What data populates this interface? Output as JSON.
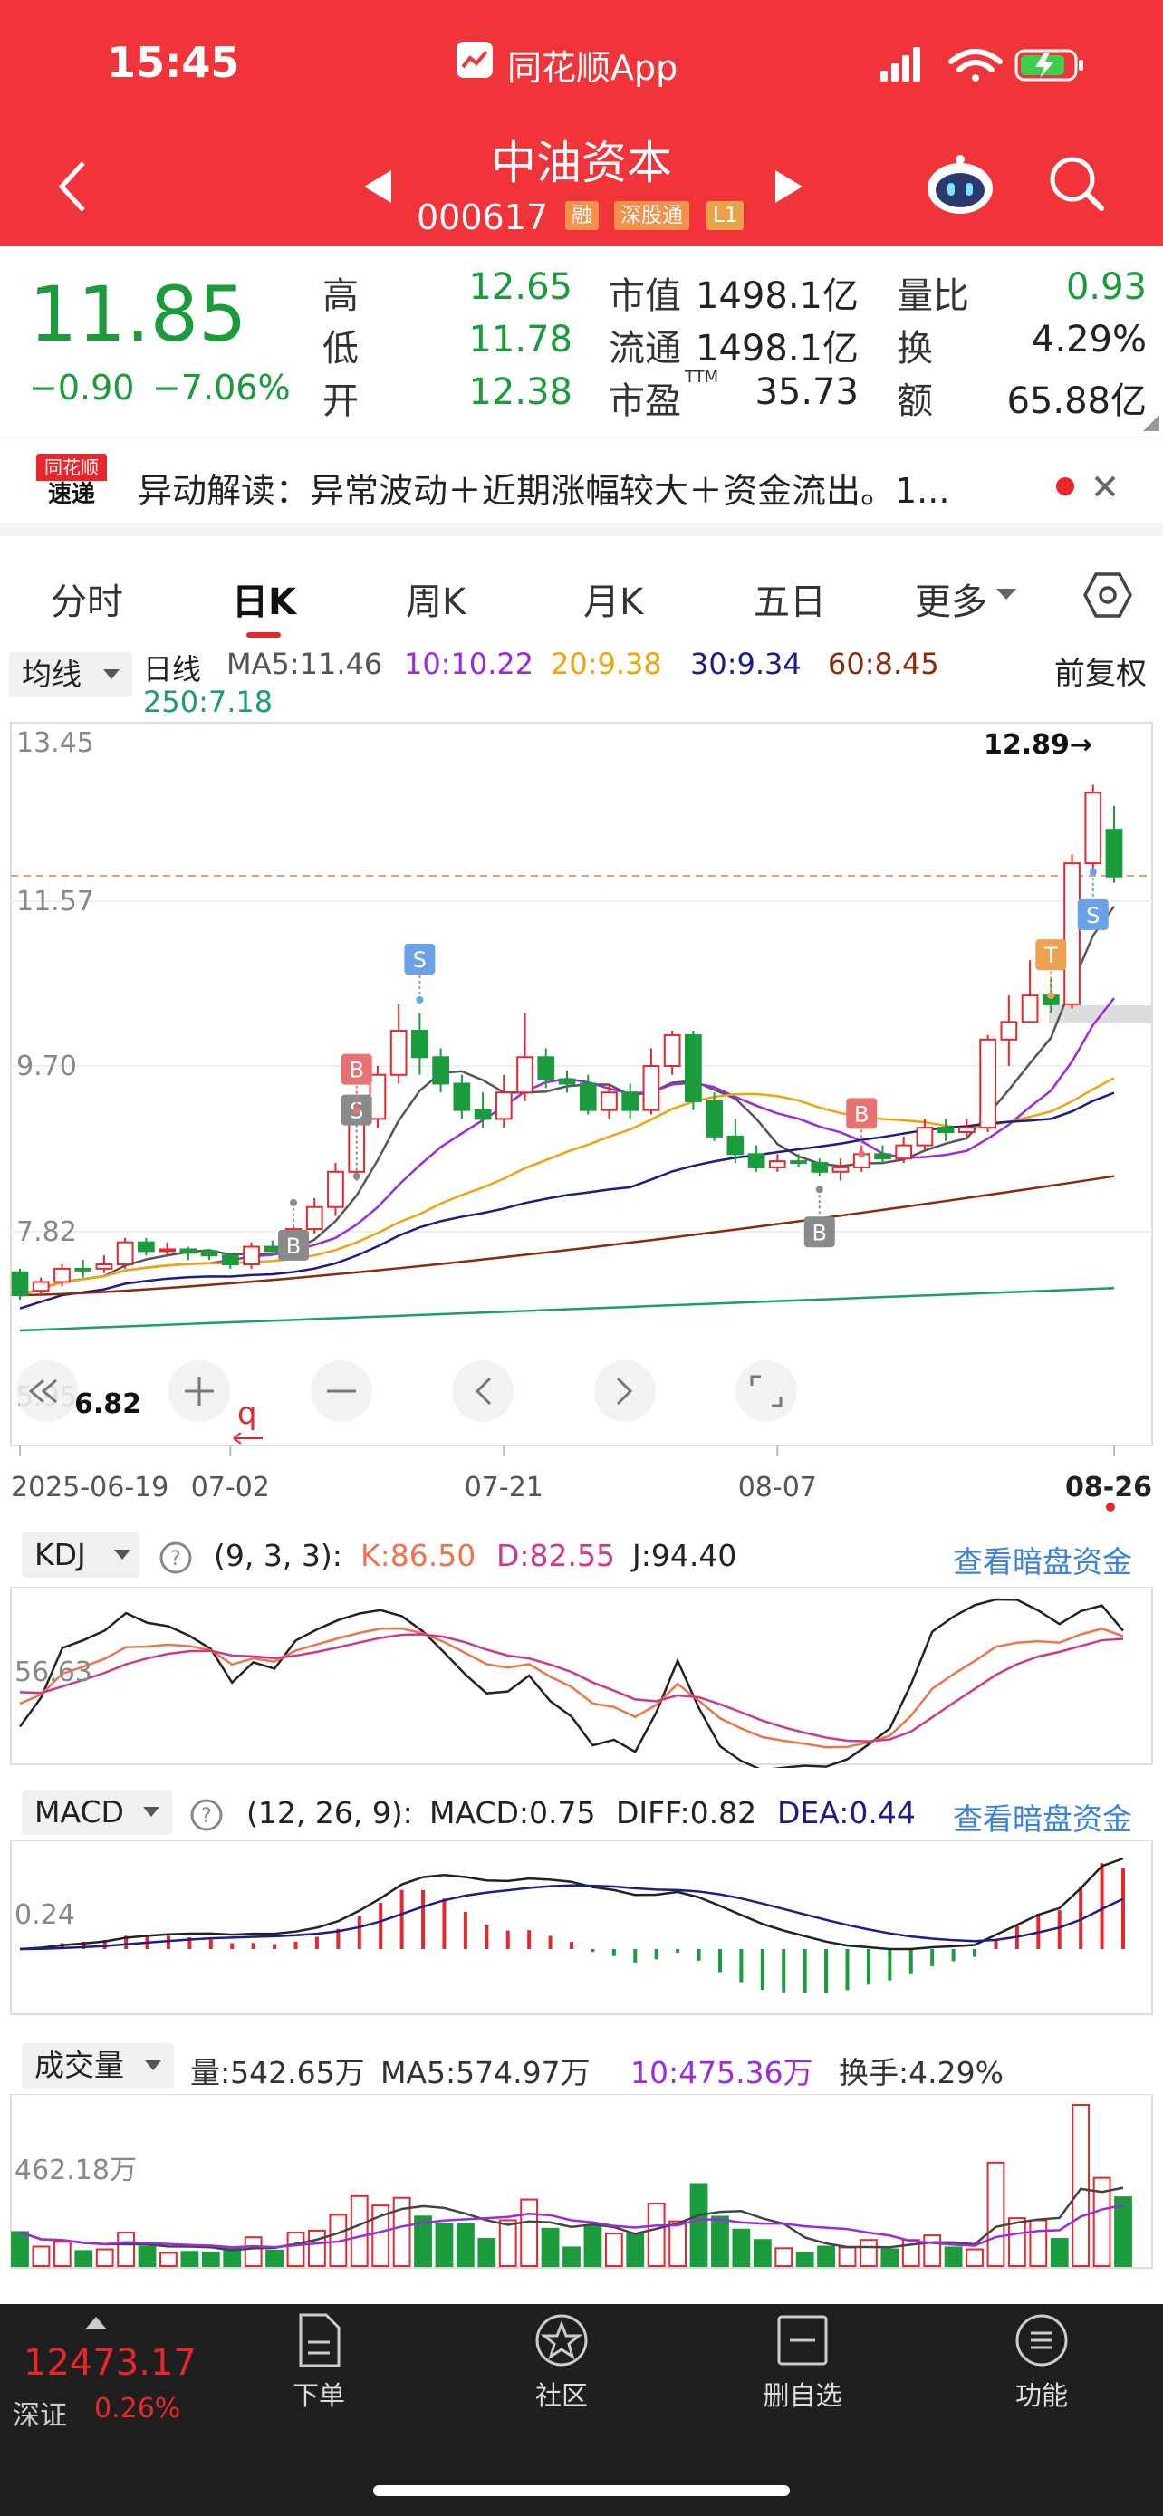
{
  "status_bar": {
    "time": "15:45",
    "app_name": "同花顺App"
  },
  "header": {
    "stock_name": "中油资本",
    "stock_code": "000617",
    "tags": [
      "融",
      "深股通",
      "L1"
    ]
  },
  "colors": {
    "header_red": "#f0343a",
    "up_red": "#e8262b",
    "down_green": "#1a9c3c",
    "link_blue": "#3b82e0",
    "ma5": "#555555",
    "ma10": "#9b2ae0",
    "ma20": "#f0a30a",
    "ma30": "#1c1c8c",
    "ma60": "#8b2b0b",
    "ma250": "#1a9e6e"
  },
  "quote": {
    "price": "11.85",
    "change": "−0.90",
    "change_pct": "−7.06%",
    "high_label": "高",
    "high": "12.65",
    "low_label": "低",
    "low": "11.78",
    "open_label": "开",
    "open": "12.38",
    "mcap_label": "市值",
    "mcap": "1498.1亿",
    "float_label": "流通",
    "float": "1498.1亿",
    "pe_label": "市盈",
    "pe_sup": "TTM",
    "pe": "35.73",
    "vr_label": "量比",
    "vr": "0.93",
    "turnover_label": "换",
    "turnover": "4.29%",
    "amount_label": "额",
    "amount": "65.88亿"
  },
  "news": {
    "logo_top": "同花顺",
    "logo_bottom": "速递",
    "text": "异动解读：异常波动＋近期涨幅较大＋资金流出。1..."
  },
  "tabs": [
    "分时",
    "日K",
    "周K",
    "月K",
    "五日",
    "更多"
  ],
  "indicator": {
    "selector": "均线",
    "period": "日线",
    "ma5": "MA5:11.46",
    "ma10": "10:10.22",
    "ma20": "20:9.38",
    "ma30": "30:9.34",
    "ma60": "60:8.45",
    "ma250": "250:7.18",
    "adjust": "前复权"
  },
  "chart_data": [
    {
      "type": "candlestick",
      "title": "日线",
      "y_ticks": [
        "13.45",
        "11.57",
        "9.70",
        "7.82",
        "5.95"
      ],
      "x_ticks": [
        "2025-06-19",
        "07-02",
        "07-21",
        "08-07",
        "08-26"
      ],
      "ylim": [
        5.95,
        13.45
      ],
      "annotations": {
        "max": "12.89→",
        "min": "6.82"
      },
      "markers": [
        "B",
        "S",
        "B",
        "S",
        "B",
        "B",
        "T",
        "S"
      ],
      "candles": [
        [
          7.36,
          7.1,
          7.4,
          7.05
        ],
        [
          7.15,
          7.25,
          7.3,
          7.1
        ],
        [
          7.25,
          7.4,
          7.45,
          7.2
        ],
        [
          7.4,
          7.38,
          7.5,
          7.3
        ],
        [
          7.4,
          7.45,
          7.55,
          7.35
        ],
        [
          7.45,
          7.7,
          7.75,
          7.4
        ],
        [
          7.7,
          7.6,
          7.75,
          7.55
        ],
        [
          7.6,
          7.62,
          7.7,
          7.55
        ],
        [
          7.62,
          7.58,
          7.65,
          7.5
        ],
        [
          7.6,
          7.55,
          7.62,
          7.5
        ],
        [
          7.55,
          7.45,
          7.58,
          7.4
        ],
        [
          7.45,
          7.65,
          7.7,
          7.4
        ],
        [
          7.65,
          7.6,
          7.72,
          7.55
        ],
        [
          7.6,
          7.85,
          7.9,
          7.55
        ],
        [
          7.85,
          8.1,
          8.2,
          7.8
        ],
        [
          8.1,
          8.5,
          8.6,
          8.0
        ],
        [
          8.5,
          9.1,
          9.2,
          8.4
        ],
        [
          9.1,
          9.6,
          9.7,
          9.0
        ],
        [
          9.6,
          10.1,
          10.4,
          9.5
        ],
        [
          10.1,
          9.8,
          10.3,
          9.6
        ],
        [
          9.8,
          9.5,
          9.9,
          9.4
        ],
        [
          9.5,
          9.2,
          9.6,
          9.1
        ],
        [
          9.2,
          9.1,
          9.4,
          9.0
        ],
        [
          9.1,
          9.4,
          9.6,
          9.0
        ],
        [
          9.4,
          9.8,
          10.3,
          9.3
        ],
        [
          9.8,
          9.55,
          9.9,
          9.45
        ],
        [
          9.55,
          9.5,
          9.65,
          9.4
        ],
        [
          9.5,
          9.2,
          9.6,
          9.15
        ],
        [
          9.2,
          9.4,
          9.5,
          9.1
        ],
        [
          9.4,
          9.2,
          9.5,
          9.1
        ],
        [
          9.2,
          9.7,
          9.9,
          9.15
        ],
        [
          9.7,
          10.05,
          10.1,
          9.6
        ],
        [
          10.05,
          9.3,
          10.1,
          9.2
        ],
        [
          9.3,
          8.9,
          9.4,
          8.85
        ],
        [
          8.9,
          8.7,
          9.1,
          8.6
        ],
        [
          8.7,
          8.55,
          8.8,
          8.5
        ],
        [
          8.55,
          8.62,
          8.7,
          8.5
        ],
        [
          8.62,
          8.6,
          8.7,
          8.55
        ],
        [
          8.6,
          8.5,
          8.65,
          8.45
        ],
        [
          8.5,
          8.55,
          8.65,
          8.4
        ],
        [
          8.55,
          8.7,
          8.8,
          8.5
        ],
        [
          8.7,
          8.65,
          8.8,
          8.6
        ],
        [
          8.65,
          8.8,
          8.9,
          8.6
        ],
        [
          8.8,
          9.0,
          9.1,
          8.75
        ],
        [
          9.0,
          8.95,
          9.1,
          8.85
        ],
        [
          8.95,
          9.0,
          9.1,
          8.9
        ],
        [
          9.0,
          10.0,
          10.05,
          8.95
        ],
        [
          10.0,
          10.2,
          10.5,
          9.7
        ],
        [
          10.2,
          10.5,
          10.9,
          10.3
        ],
        [
          10.5,
          10.4,
          10.7,
          10.3
        ],
        [
          10.4,
          12.0,
          12.1,
          10.35
        ],
        [
          12.0,
          12.8,
          12.89,
          11.9
        ],
        [
          12.38,
          11.85,
          12.65,
          11.78
        ]
      ]
    },
    {
      "type": "line",
      "title": "KDJ",
      "params": "(9, 3, 3):",
      "k": "K:86.50",
      "d": "D:82.55",
      "j": "J:94.40",
      "y_tick": "56.63",
      "link": "查看暗盘资金"
    },
    {
      "type": "bar",
      "title": "MACD",
      "params": "(12, 26, 9):",
      "macd": "MACD:0.75",
      "diff": "DIFF:0.82",
      "dea": "DEA:0.44",
      "y_tick": "0.24",
      "link": "查看暗盘资金"
    },
    {
      "type": "bar",
      "title": "成交量",
      "vol": "量:542.65万",
      "ma5": "MA5:574.97万",
      "ma10": "10:475.36万",
      "turn": "换手:4.29%",
      "y_tick": "462.18万"
    }
  ],
  "bottom": {
    "index_value": "12473.17",
    "index_name": "深证",
    "index_pct": "0.26%",
    "items": [
      "下单",
      "社区",
      "删自选",
      "功能"
    ]
  }
}
